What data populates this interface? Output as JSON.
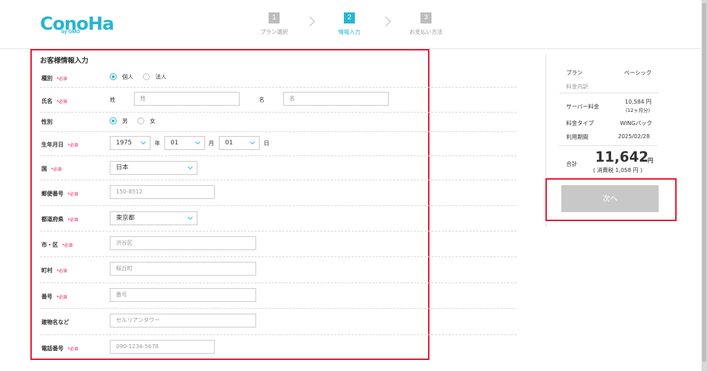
{
  "brand": {
    "logo_text": "ConoHa",
    "logo_sub": "by GMO",
    "accent": "#28b6cf"
  },
  "steps": [
    {
      "num": "1",
      "label": "プラン選択",
      "active": false
    },
    {
      "num": "2",
      "label": "情報入力",
      "active": true
    },
    {
      "num": "3",
      "label": "お支払い方法",
      "active": false
    }
  ],
  "form": {
    "title": "お客様情報入力",
    "required_mark": "*必須",
    "type": {
      "label": "種別",
      "options": [
        "個人",
        "法人"
      ],
      "selected": "個人"
    },
    "name": {
      "label": "氏名",
      "last_label": "姓",
      "last_placeholder": "姓",
      "first_label": "名",
      "first_placeholder": "名"
    },
    "gender": {
      "label": "性別",
      "options": [
        "男",
        "女"
      ],
      "selected": "男"
    },
    "birth": {
      "label": "生年月日",
      "year": "1975",
      "year_unit": "年",
      "month": "01",
      "month_unit": "月",
      "day": "01",
      "day_unit": "日"
    },
    "country": {
      "label": "国",
      "value": "日本"
    },
    "postal": {
      "label": "郵便番号",
      "placeholder": "150-8512"
    },
    "prefecture": {
      "label": "都道府県",
      "value": "東京都"
    },
    "city": {
      "label": "市・区",
      "placeholder": "渋谷区"
    },
    "town": {
      "label": "町村",
      "placeholder": "桜丘町"
    },
    "number": {
      "label": "番号",
      "placeholder": "番号"
    },
    "building": {
      "label": "建物名など",
      "placeholder": "セルリアンタワー"
    },
    "phone": {
      "label": "電話番号",
      "placeholder": "090-1234-5678"
    }
  },
  "summary": {
    "plan_label": "プラン",
    "plan_value": "ベーシック",
    "breakdown_label": "料金内訳",
    "server_fee_label": "サーバー料金",
    "server_fee_value": "10,584 円",
    "server_fee_note": "(12ヶ月分)",
    "fee_type_label": "料金タイプ",
    "fee_type_value": "WINGパック",
    "period_label": "利用期間",
    "period_value": "2025/02/28",
    "total_label": "合計",
    "total_value": "11,642",
    "total_unit": "円",
    "tax_note": "( 消費税 1,058 円 )"
  },
  "next_button": "次へ"
}
